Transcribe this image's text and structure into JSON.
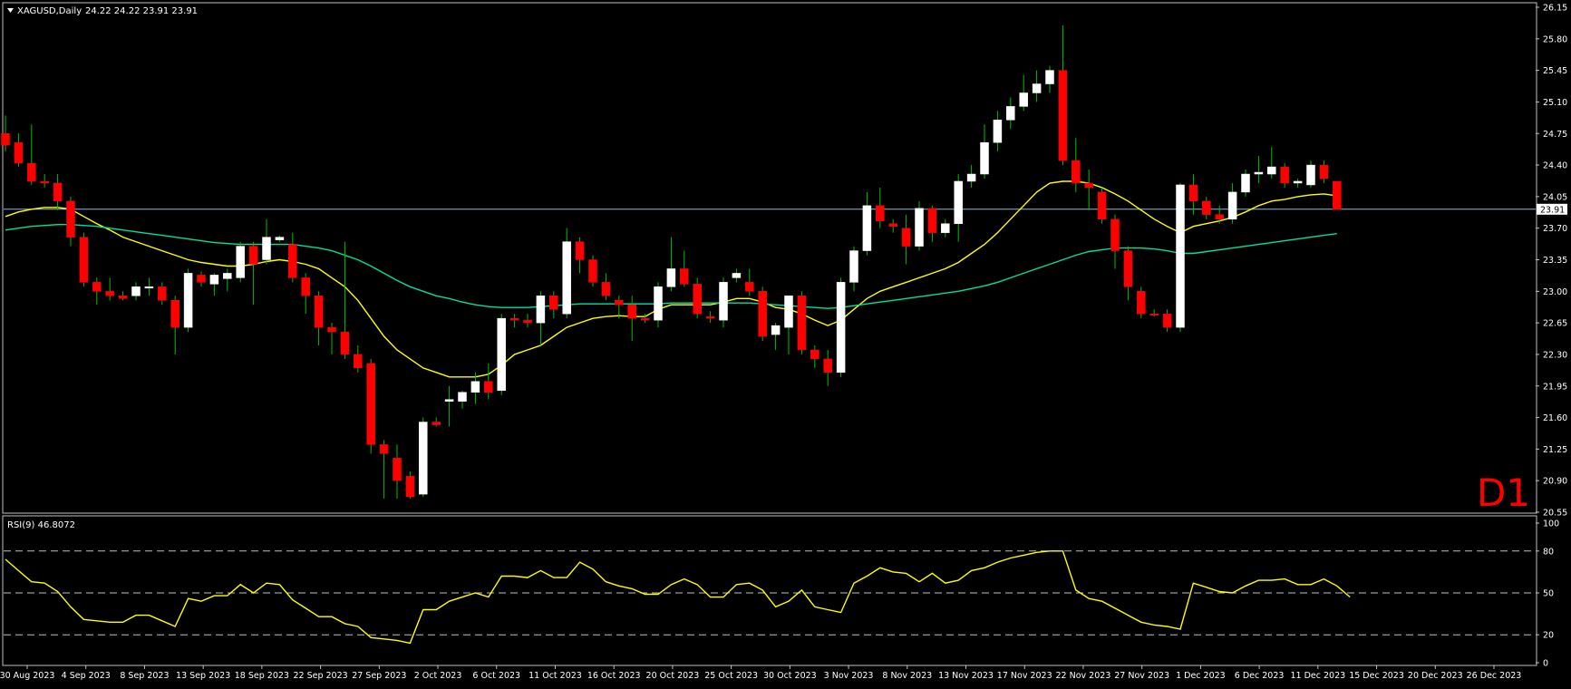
{
  "header": {
    "symbol_line": "XAGUSD,Daily",
    "ohlc_line": "24.22 24.22 23.91 23.91",
    "timeframe_watermark": "D1"
  },
  "rsi_panel": {
    "label": "RSI(9) 46.8072"
  },
  "colors": {
    "background": "#000000",
    "frame": "#c0c0c0",
    "bull_candle": "#ffffff",
    "bear_candle": "#ff0000",
    "wick": "#00c000",
    "ma_fast": "#ffff00",
    "ma_slow": "#00e0a0",
    "rsi_line": "#ffff00",
    "current_price_line": "#8fb8d8",
    "watermark": "#ff0000"
  },
  "chart_data": [
    {
      "type": "candlestick",
      "symbol": "XAGUSD",
      "timeframe": "Daily",
      "ylim": [
        20.55,
        26.15
      ],
      "y_ticks": [
        "26.15",
        "25.80",
        "25.45",
        "25.10",
        "24.75",
        "24.40",
        "24.05",
        "23.70",
        "23.35",
        "23.00",
        "22.65",
        "22.30",
        "21.95",
        "21.60",
        "21.25",
        "20.90",
        "20.55"
      ],
      "current_price": "23.91",
      "x_tick_labels": [
        "30 Aug 2023",
        "4 Sep 2023",
        "8 Sep 2023",
        "13 Sep 2023",
        "18 Sep 2023",
        "22 Sep 2023",
        "27 Sep 2023",
        "2 Oct 2023",
        "6 Oct 2023",
        "11 Oct 2023",
        "16 Oct 2023",
        "20 Oct 2023",
        "25 Oct 2023",
        "30 Oct 2023",
        "3 Nov 2023",
        "8 Nov 2023",
        "13 Nov 2023",
        "17 Nov 2023",
        "22 Nov 2023",
        "27 Nov 2023",
        "1 Dec 2023",
        "6 Dec 2023",
        "11 Dec 2023",
        "15 Dec 2023",
        "20 Dec 2023",
        "26 Dec 2023"
      ],
      "candles": [
        {
          "o": 24.75,
          "h": 24.95,
          "l": 24.55,
          "c": 24.62
        },
        {
          "o": 24.65,
          "h": 24.75,
          "l": 24.38,
          "c": 24.42
        },
        {
          "o": 24.42,
          "h": 24.85,
          "l": 24.18,
          "c": 24.22
        },
        {
          "o": 24.22,
          "h": 24.3,
          "l": 24.15,
          "c": 24.2
        },
        {
          "o": 24.2,
          "h": 24.3,
          "l": 23.9,
          "c": 24.0
        },
        {
          "o": 24.0,
          "h": 24.05,
          "l": 23.5,
          "c": 23.6
        },
        {
          "o": 23.6,
          "h": 23.65,
          "l": 23.05,
          "c": 23.1
        },
        {
          "o": 23.1,
          "h": 23.15,
          "l": 22.85,
          "c": 23.0
        },
        {
          "o": 23.0,
          "h": 23.15,
          "l": 22.9,
          "c": 22.95
        },
        {
          "o": 22.95,
          "h": 23.0,
          "l": 22.9,
          "c": 22.92
        },
        {
          "o": 22.95,
          "h": 23.1,
          "l": 22.9,
          "c": 23.05
        },
        {
          "o": 23.04,
          "h": 23.15,
          "l": 22.95,
          "c": 23.05
        },
        {
          "o": 23.05,
          "h": 23.1,
          "l": 22.85,
          "c": 22.9
        },
        {
          "o": 22.9,
          "h": 22.95,
          "l": 22.3,
          "c": 22.6
        },
        {
          "o": 22.6,
          "h": 23.25,
          "l": 22.55,
          "c": 23.2
        },
        {
          "o": 23.18,
          "h": 23.22,
          "l": 23.05,
          "c": 23.1
        },
        {
          "o": 23.08,
          "h": 23.2,
          "l": 22.95,
          "c": 23.18
        },
        {
          "o": 23.14,
          "h": 23.25,
          "l": 23.0,
          "c": 23.2
        },
        {
          "o": 23.15,
          "h": 23.55,
          "l": 23.1,
          "c": 23.5
        },
        {
          "o": 23.5,
          "h": 23.55,
          "l": 22.85,
          "c": 23.3
        },
        {
          "o": 23.35,
          "h": 23.8,
          "l": 23.3,
          "c": 23.6
        },
        {
          "o": 23.57,
          "h": 23.62,
          "l": 23.55,
          "c": 23.6
        },
        {
          "o": 23.52,
          "h": 23.65,
          "l": 23.1,
          "c": 23.15
        },
        {
          "o": 23.15,
          "h": 23.2,
          "l": 22.75,
          "c": 22.95
        },
        {
          "o": 22.95,
          "h": 23.0,
          "l": 22.4,
          "c": 22.6
        },
        {
          "o": 22.6,
          "h": 22.65,
          "l": 22.3,
          "c": 22.55
        },
        {
          "o": 22.55,
          "h": 23.55,
          "l": 22.25,
          "c": 22.3
        },
        {
          "o": 22.3,
          "h": 22.4,
          "l": 22.1,
          "c": 22.15
        },
        {
          "o": 22.2,
          "h": 22.25,
          "l": 21.2,
          "c": 21.3
        },
        {
          "o": 21.3,
          "h": 21.35,
          "l": 20.7,
          "c": 21.2
        },
        {
          "o": 21.15,
          "h": 21.3,
          "l": 20.7,
          "c": 20.9
        },
        {
          "o": 20.95,
          "h": 21.0,
          "l": 20.7,
          "c": 20.72
        },
        {
          "o": 20.75,
          "h": 21.6,
          "l": 20.72,
          "c": 21.55
        },
        {
          "o": 21.55,
          "h": 21.6,
          "l": 21.5,
          "c": 21.52
        },
        {
          "o": 21.78,
          "h": 21.95,
          "l": 21.5,
          "c": 21.8
        },
        {
          "o": 21.78,
          "h": 21.9,
          "l": 21.7,
          "c": 21.88
        },
        {
          "o": 21.88,
          "h": 22.1,
          "l": 21.75,
          "c": 22.0
        },
        {
          "o": 22.0,
          "h": 22.2,
          "l": 21.8,
          "c": 21.88
        },
        {
          "o": 21.9,
          "h": 22.75,
          "l": 21.85,
          "c": 22.7
        },
        {
          "o": 22.7,
          "h": 22.75,
          "l": 22.6,
          "c": 22.68
        },
        {
          "o": 22.68,
          "h": 22.75,
          "l": 22.6,
          "c": 22.65
        },
        {
          "o": 22.65,
          "h": 23.0,
          "l": 22.4,
          "c": 22.95
        },
        {
          "o": 22.95,
          "h": 23.0,
          "l": 22.7,
          "c": 22.8
        },
        {
          "o": 22.75,
          "h": 23.7,
          "l": 22.7,
          "c": 23.55
        },
        {
          "o": 23.55,
          "h": 23.6,
          "l": 23.2,
          "c": 23.35
        },
        {
          "o": 23.35,
          "h": 23.4,
          "l": 23.05,
          "c": 23.1
        },
        {
          "o": 23.1,
          "h": 23.2,
          "l": 22.9,
          "c": 22.95
        },
        {
          "o": 22.9,
          "h": 22.95,
          "l": 22.7,
          "c": 22.85
        },
        {
          "o": 22.85,
          "h": 22.95,
          "l": 22.45,
          "c": 22.7
        },
        {
          "o": 22.7,
          "h": 22.75,
          "l": 22.65,
          "c": 22.68
        },
        {
          "o": 22.68,
          "h": 23.1,
          "l": 22.6,
          "c": 23.05
        },
        {
          "o": 23.05,
          "h": 23.6,
          "l": 23.0,
          "c": 23.25
        },
        {
          "o": 23.25,
          "h": 23.45,
          "l": 23.05,
          "c": 23.08
        },
        {
          "o": 23.08,
          "h": 23.15,
          "l": 22.7,
          "c": 22.75
        },
        {
          "o": 22.72,
          "h": 22.78,
          "l": 22.65,
          "c": 22.7
        },
        {
          "o": 22.68,
          "h": 23.15,
          "l": 22.6,
          "c": 23.1
        },
        {
          "o": 23.15,
          "h": 23.25,
          "l": 23.1,
          "c": 23.2
        },
        {
          "o": 23.1,
          "h": 23.25,
          "l": 22.95,
          "c": 23.0
        },
        {
          "o": 23.0,
          "h": 23.05,
          "l": 22.45,
          "c": 22.5
        },
        {
          "o": 22.52,
          "h": 22.65,
          "l": 22.35,
          "c": 22.62
        },
        {
          "o": 22.6,
          "h": 22.95,
          "l": 22.3,
          "c": 22.95
        },
        {
          "o": 22.95,
          "h": 23.0,
          "l": 22.3,
          "c": 22.35
        },
        {
          "o": 22.35,
          "h": 22.4,
          "l": 22.15,
          "c": 22.25
        },
        {
          "o": 22.25,
          "h": 22.35,
          "l": 21.95,
          "c": 22.1
        },
        {
          "o": 22.1,
          "h": 23.15,
          "l": 22.05,
          "c": 23.1
        },
        {
          "o": 23.1,
          "h": 23.5,
          "l": 23.0,
          "c": 23.45
        },
        {
          "o": 23.45,
          "h": 24.1,
          "l": 23.4,
          "c": 23.95
        },
        {
          "o": 23.95,
          "h": 24.15,
          "l": 23.7,
          "c": 23.78
        },
        {
          "o": 23.75,
          "h": 23.8,
          "l": 23.65,
          "c": 23.72
        },
        {
          "o": 23.7,
          "h": 23.85,
          "l": 23.3,
          "c": 23.5
        },
        {
          "o": 23.5,
          "h": 24.0,
          "l": 23.45,
          "c": 23.92
        },
        {
          "o": 23.92,
          "h": 23.95,
          "l": 23.55,
          "c": 23.65
        },
        {
          "o": 23.65,
          "h": 23.8,
          "l": 23.6,
          "c": 23.75
        },
        {
          "o": 23.75,
          "h": 24.3,
          "l": 23.55,
          "c": 24.22
        },
        {
          "o": 24.22,
          "h": 24.4,
          "l": 24.15,
          "c": 24.3
        },
        {
          "o": 24.3,
          "h": 24.85,
          "l": 24.25,
          "c": 24.65
        },
        {
          "o": 24.65,
          "h": 25.0,
          "l": 24.55,
          "c": 24.9
        },
        {
          "o": 24.9,
          "h": 25.15,
          "l": 24.8,
          "c": 25.05
        },
        {
          "o": 25.05,
          "h": 25.4,
          "l": 25.0,
          "c": 25.2
        },
        {
          "o": 25.2,
          "h": 25.45,
          "l": 25.1,
          "c": 25.3
        },
        {
          "o": 25.3,
          "h": 25.5,
          "l": 25.2,
          "c": 25.45
        },
        {
          "o": 25.45,
          "h": 25.95,
          "l": 24.4,
          "c": 24.45
        },
        {
          "o": 24.45,
          "h": 24.7,
          "l": 24.1,
          "c": 24.2
        },
        {
          "o": 24.2,
          "h": 24.35,
          "l": 23.9,
          "c": 24.15
        },
        {
          "o": 24.1,
          "h": 24.15,
          "l": 23.75,
          "c": 23.8
        },
        {
          "o": 23.8,
          "h": 23.85,
          "l": 23.25,
          "c": 23.45
        },
        {
          "o": 23.45,
          "h": 23.5,
          "l": 22.9,
          "c": 23.05
        },
        {
          "o": 23.0,
          "h": 23.05,
          "l": 22.7,
          "c": 22.75
        },
        {
          "o": 22.75,
          "h": 22.8,
          "l": 22.72,
          "c": 22.74
        },
        {
          "o": 22.75,
          "h": 22.8,
          "l": 22.55,
          "c": 22.6
        },
        {
          "o": 22.6,
          "h": 24.2,
          "l": 22.55,
          "c": 24.18
        },
        {
          "o": 24.18,
          "h": 24.3,
          "l": 23.85,
          "c": 24.0
        },
        {
          "o": 24.0,
          "h": 24.05,
          "l": 23.8,
          "c": 23.85
        },
        {
          "o": 23.85,
          "h": 23.95,
          "l": 23.75,
          "c": 23.8
        },
        {
          "o": 23.8,
          "h": 24.2,
          "l": 23.75,
          "c": 24.1
        },
        {
          "o": 24.1,
          "h": 24.35,
          "l": 24.05,
          "c": 24.3
        },
        {
          "o": 24.3,
          "h": 24.5,
          "l": 24.2,
          "c": 24.32
        },
        {
          "o": 24.3,
          "h": 24.6,
          "l": 24.25,
          "c": 24.38
        },
        {
          "o": 24.38,
          "h": 24.42,
          "l": 24.15,
          "c": 24.2
        },
        {
          "o": 24.2,
          "h": 24.25,
          "l": 24.15,
          "c": 24.22
        },
        {
          "o": 24.18,
          "h": 24.45,
          "l": 24.15,
          "c": 24.4
        },
        {
          "o": 24.4,
          "h": 24.45,
          "l": 24.2,
          "c": 24.25
        },
        {
          "o": 24.22,
          "h": 24.22,
          "l": 23.91,
          "c": 23.91
        }
      ],
      "series": [
        {
          "type": "line",
          "values": [
            23.83,
            23.88,
            23.91,
            23.93,
            23.93,
            23.91,
            23.83,
            23.75,
            23.68,
            23.6,
            23.55,
            23.5,
            23.45,
            23.4,
            23.35,
            23.32,
            23.3,
            23.28,
            23.28,
            23.3,
            23.33,
            23.35,
            23.33,
            23.3,
            23.25,
            23.15,
            23.05,
            22.9,
            22.7,
            22.5,
            22.35,
            22.25,
            22.15,
            22.1,
            22.05,
            22.05,
            22.05,
            22.08,
            22.18,
            22.3,
            22.35,
            22.4,
            22.5,
            22.6,
            22.65,
            22.7,
            22.72,
            22.73,
            22.72,
            22.72,
            22.8,
            22.85,
            22.85,
            22.85,
            22.85,
            22.88,
            22.92,
            22.92,
            22.88,
            22.82,
            22.8,
            22.75,
            22.68,
            22.62,
            22.68,
            22.8,
            22.92,
            23.0,
            23.05,
            23.1,
            23.15,
            23.2,
            23.25,
            23.32,
            23.42,
            23.52,
            23.65,
            23.8,
            23.95,
            24.1,
            24.2,
            24.22,
            24.22,
            24.2,
            24.15,
            24.08,
            24.0,
            23.9,
            23.8,
            23.72,
            23.65,
            23.72,
            23.75,
            23.78,
            23.82,
            23.88,
            23.95,
            24.0,
            24.02,
            24.05,
            24.07,
            24.08,
            24.06
          ]
        },
        {
          "type": "line",
          "values": [
            23.68,
            23.7,
            23.72,
            23.73,
            23.74,
            23.74,
            23.73,
            23.72,
            23.7,
            23.68,
            23.66,
            23.64,
            23.62,
            23.6,
            23.58,
            23.56,
            23.54,
            23.53,
            23.52,
            23.52,
            23.52,
            23.52,
            23.52,
            23.5,
            23.48,
            23.45,
            23.4,
            23.35,
            23.28,
            23.2,
            23.12,
            23.05,
            23.0,
            22.95,
            22.92,
            22.88,
            22.85,
            22.83,
            22.82,
            22.82,
            22.82,
            22.83,
            22.84,
            22.85,
            22.86,
            22.86,
            22.86,
            22.86,
            22.86,
            22.86,
            22.86,
            22.87,
            22.87,
            22.87,
            22.87,
            22.87,
            22.87,
            22.87,
            22.86,
            22.85,
            22.84,
            22.83,
            22.82,
            22.81,
            22.82,
            22.84,
            22.86,
            22.88,
            22.9,
            22.92,
            22.94,
            22.96,
            22.98,
            23.0,
            23.03,
            23.06,
            23.1,
            23.15,
            23.2,
            23.25,
            23.3,
            23.35,
            23.4,
            23.44,
            23.46,
            23.48,
            23.48,
            23.48,
            23.47,
            23.45,
            23.42,
            23.42,
            23.44,
            23.46,
            23.48,
            23.5,
            23.52,
            23.54,
            23.56,
            23.58,
            23.6,
            23.62,
            23.64
          ]
        }
      ]
    },
    {
      "type": "line",
      "title": "RSI(9) 46.8072",
      "ylim": [
        0,
        100
      ],
      "y_ticks": [
        "100",
        "80",
        "50",
        "20",
        "0"
      ],
      "levels": [
        80,
        50,
        20
      ],
      "series": [
        {
          "values": [
            74,
            66,
            58,
            57,
            51,
            40,
            31,
            30,
            29,
            29,
            34,
            34,
            30,
            26,
            46,
            44,
            48,
            48,
            56,
            50,
            57,
            56,
            45,
            39,
            33,
            33,
            28,
            26,
            18,
            17,
            16,
            14,
            38,
            38,
            44,
            47,
            50,
            47,
            62,
            62,
            61,
            66,
            61,
            61,
            72,
            67,
            58,
            55,
            53,
            49,
            49,
            56,
            60,
            56,
            47,
            47,
            56,
            57,
            52,
            40,
            44,
            52,
            40,
            38,
            36,
            57,
            62,
            68,
            65,
            64,
            58,
            64,
            57,
            59,
            66,
            68,
            72,
            75,
            77,
            79,
            80,
            80,
            52,
            46,
            44,
            39,
            34,
            29,
            27,
            26,
            24,
            57,
            54,
            51,
            50,
            55,
            59,
            59,
            60,
            56,
            56,
            60,
            55,
            47
          ]
        }
      ]
    }
  ]
}
